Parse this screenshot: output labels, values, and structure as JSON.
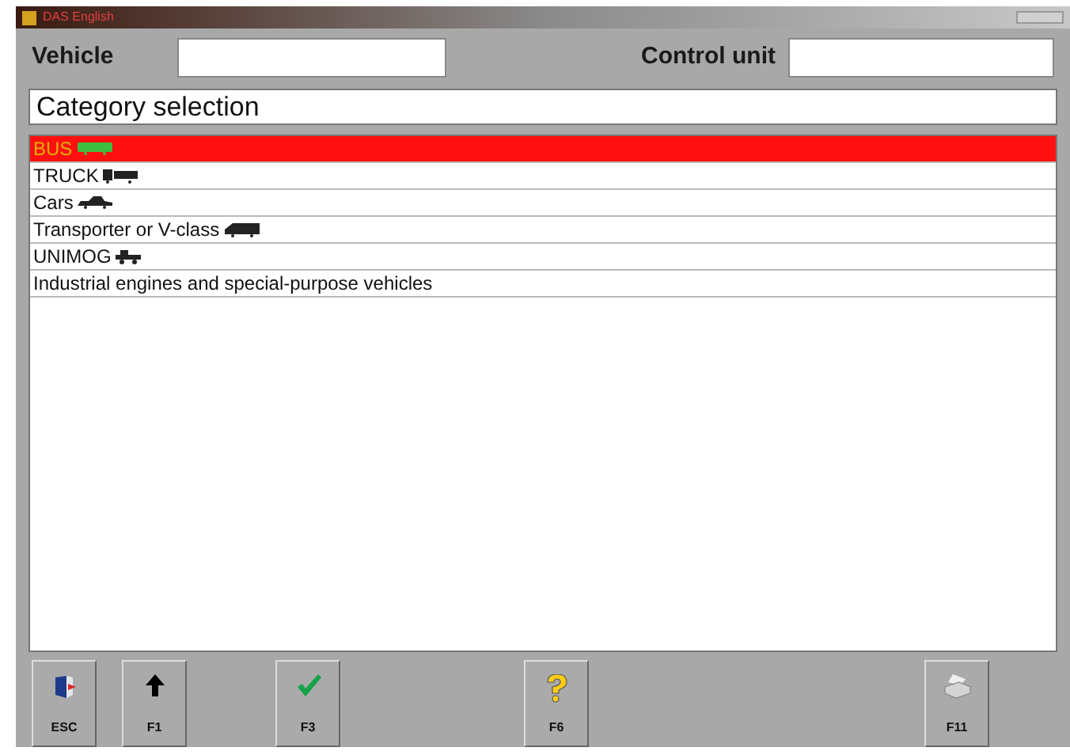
{
  "window": {
    "title": "DAS English"
  },
  "header": {
    "vehicle_label": "Vehicle",
    "control_unit_label": "Control unit"
  },
  "section_title": "Category selection",
  "categories": [
    {
      "label": "BUS",
      "kind": "bus",
      "selected": true
    },
    {
      "label": "TRUCK",
      "kind": "truck",
      "selected": false
    },
    {
      "label": "Cars",
      "kind": "car",
      "selected": false
    },
    {
      "label": "Transporter or V-class",
      "kind": "van",
      "selected": false
    },
    {
      "label": "UNIMOG",
      "kind": "unimog",
      "selected": false
    },
    {
      "label": "Industrial engines and special-purpose vehicles",
      "kind": "none",
      "selected": false
    }
  ],
  "buttons": [
    {
      "label": "ESC",
      "kind": "exit"
    },
    {
      "label": "F1",
      "kind": "up"
    },
    {
      "label": "F3",
      "kind": "ok"
    },
    {
      "label": "F6",
      "kind": "help"
    },
    {
      "label": "F11",
      "kind": "print"
    }
  ]
}
